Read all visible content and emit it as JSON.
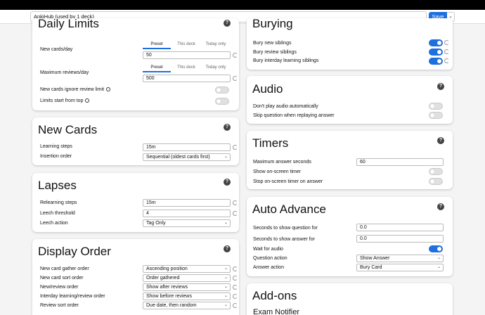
{
  "toolbar": {
    "preset": "AnkiHub (used by 1 deck)",
    "save_label": "Save"
  },
  "daily_limits": {
    "title": "Daily Limits",
    "new_cards_label": "New cards/day",
    "new_cards_tabs": [
      "Preset",
      "This deck",
      "Today only"
    ],
    "new_cards_value": "50",
    "max_reviews_label": "Maximum reviews/day",
    "max_reviews_tabs": [
      "Preset",
      "This deck",
      "Today only"
    ],
    "max_reviews_value": "500",
    "ignore_review_limit_label": "New cards ignore review limit",
    "ignore_review_limit_on": false,
    "limits_from_top_label": "Limits start from top",
    "limits_from_top_on": false
  },
  "new_cards": {
    "title": "New Cards",
    "learning_steps_label": "Learning steps",
    "learning_steps_value": "15m",
    "insertion_order_label": "Insertion order",
    "insertion_order_value": "Sequential (oldest cards first)"
  },
  "lapses": {
    "title": "Lapses",
    "relearning_steps_label": "Relearning steps",
    "relearning_steps_value": "15m",
    "leech_threshold_label": "Leech threshold",
    "leech_threshold_value": "4",
    "leech_action_label": "Leech action",
    "leech_action_value": "Tag Only"
  },
  "display_order": {
    "title": "Display Order",
    "rows": [
      {
        "label": "New card gather order",
        "value": "Ascending position"
      },
      {
        "label": "New card sort order",
        "value": "Order gathered"
      },
      {
        "label": "New/review order",
        "value": "Show after reviews"
      },
      {
        "label": "Interday learning/review order",
        "value": "Show before reviews"
      },
      {
        "label": "Review sort order",
        "value": "Due date, then random"
      }
    ]
  },
  "burying": {
    "title": "Burying",
    "bury_new_label": "Bury new siblings",
    "bury_new_on": true,
    "bury_review_label": "Bury review siblings",
    "bury_review_on": true,
    "bury_interday_label": "Bury interday learning siblings",
    "bury_interday_on": true
  },
  "audio": {
    "title": "Audio",
    "no_autoplay_label": "Don't play audio automatically",
    "no_autoplay_on": false,
    "skip_question_label": "Skip question when replaying answer",
    "skip_question_on": false
  },
  "timers": {
    "title": "Timers",
    "max_answer_label": "Maximum answer seconds",
    "max_answer_value": "60",
    "show_timer_label": "Show on-screen timer",
    "show_timer_on": false,
    "stop_timer_label": "Stop on-screen timer on answer",
    "stop_timer_on": false
  },
  "auto_advance": {
    "title": "Auto Advance",
    "question_secs_label": "Seconds to show question for",
    "question_secs_value": "0.0",
    "answer_secs_label": "Seconds to show answer for",
    "answer_secs_value": "0.0",
    "wait_audio_label": "Wait for audio",
    "wait_audio_on": true,
    "question_action_label": "Question action",
    "question_action_value": "Show Answer",
    "answer_action_label": "Answer action",
    "answer_action_value": "Bury Card"
  },
  "addons": {
    "title": "Add-ons",
    "first_addon": "Exam Notifier"
  },
  "colors": {
    "accent": "#1e6fe0",
    "background": "#f4f4f4"
  }
}
